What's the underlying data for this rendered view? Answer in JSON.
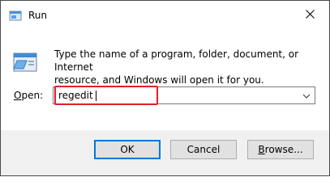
{
  "window": {
    "title": "Run",
    "title_icon": "run-icon",
    "close_icon": "close-icon"
  },
  "content": {
    "icon": "run-icon",
    "description_line1": "Type the name of a program, folder, document, or Internet",
    "description_line2": "resource, and Windows will open it for you.",
    "open_label_accel": "O",
    "open_label_rest": "pen:",
    "open_value": "regedit",
    "dropdown_icon": "chevron-down-icon"
  },
  "buttons": {
    "ok": "OK",
    "cancel": "Cancel",
    "browse_accel": "B",
    "browse_rest": "rowse..."
  },
  "colors": {
    "highlight": "#e0202a",
    "focus": "#0078d7",
    "footer_bg": "#f0f0f0"
  }
}
